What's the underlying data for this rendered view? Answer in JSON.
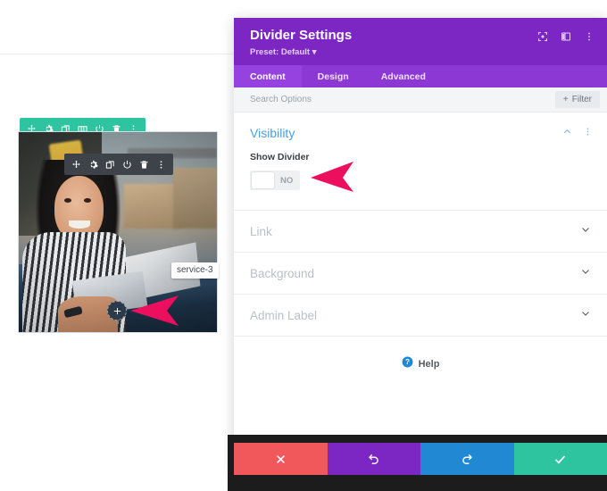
{
  "canvas": {
    "section_toolbar": {
      "name": "section-toolbar",
      "icons": [
        "move-icon",
        "gear-icon",
        "duplicate-icon",
        "columns-icon",
        "power-icon",
        "trash-icon",
        "more-options-icon"
      ]
    },
    "module_toolbar": {
      "name": "module-toolbar",
      "icons": [
        "move-icon",
        "gear-icon",
        "duplicate-icon",
        "power-icon",
        "trash-icon",
        "more-options-icon"
      ]
    },
    "module_tooltip": "service-3",
    "add_module_label": "+",
    "image_alt": "Smiling woman in striped shirt holding a document at a desk in a warehouse office"
  },
  "modal": {
    "title": "Divider Settings",
    "preset": "Preset: Default",
    "header_icons": [
      "focus-icon",
      "layout-icon",
      "more-options-icon"
    ],
    "tabs": [
      {
        "label": "Content",
        "active": true
      },
      {
        "label": "Design",
        "active": false
      },
      {
        "label": "Advanced",
        "active": false
      }
    ],
    "search": {
      "placeholder": "Search Options"
    },
    "filter": {
      "label": "Filter",
      "icon": "plus-icon"
    },
    "sections": {
      "visibility": {
        "title": "Visibility",
        "expanded": true,
        "collapse_icon": "chevron-up-icon",
        "more_icon": "more-options-icon",
        "fields": [
          {
            "label": "Show Divider",
            "type": "toggle",
            "value": "NO",
            "enabled": false
          }
        ]
      },
      "collapsed": [
        {
          "title": "Link",
          "icon": "chevron-down-icon"
        },
        {
          "title": "Background",
          "icon": "chevron-down-icon"
        },
        {
          "title": "Admin Label",
          "icon": "chevron-down-icon"
        }
      ]
    },
    "help": {
      "label": "Help",
      "icon": "help-icon"
    },
    "footer_buttons": [
      {
        "name": "cancel-button",
        "icon": "close-icon",
        "color": "#f0585b"
      },
      {
        "name": "undo-button",
        "icon": "undo-icon",
        "color": "#7c27c4"
      },
      {
        "name": "redo-button",
        "icon": "redo-icon",
        "color": "#2188d3"
      },
      {
        "name": "save-button",
        "icon": "check-icon",
        "color": "#2ec4a0"
      }
    ]
  },
  "annotations": {
    "arrow_color": "#ec0f5e",
    "arrows": [
      "arrow-pointing-to-add-module-button",
      "arrow-pointing-to-show-divider-toggle"
    ]
  },
  "colors": {
    "modal_header": "#7c27c4",
    "tabs_bar": "#8b38d4",
    "accent_blue": "#4a9fe0",
    "teal": "#2ec4a0",
    "dark_toolbar": "#3e4349"
  }
}
